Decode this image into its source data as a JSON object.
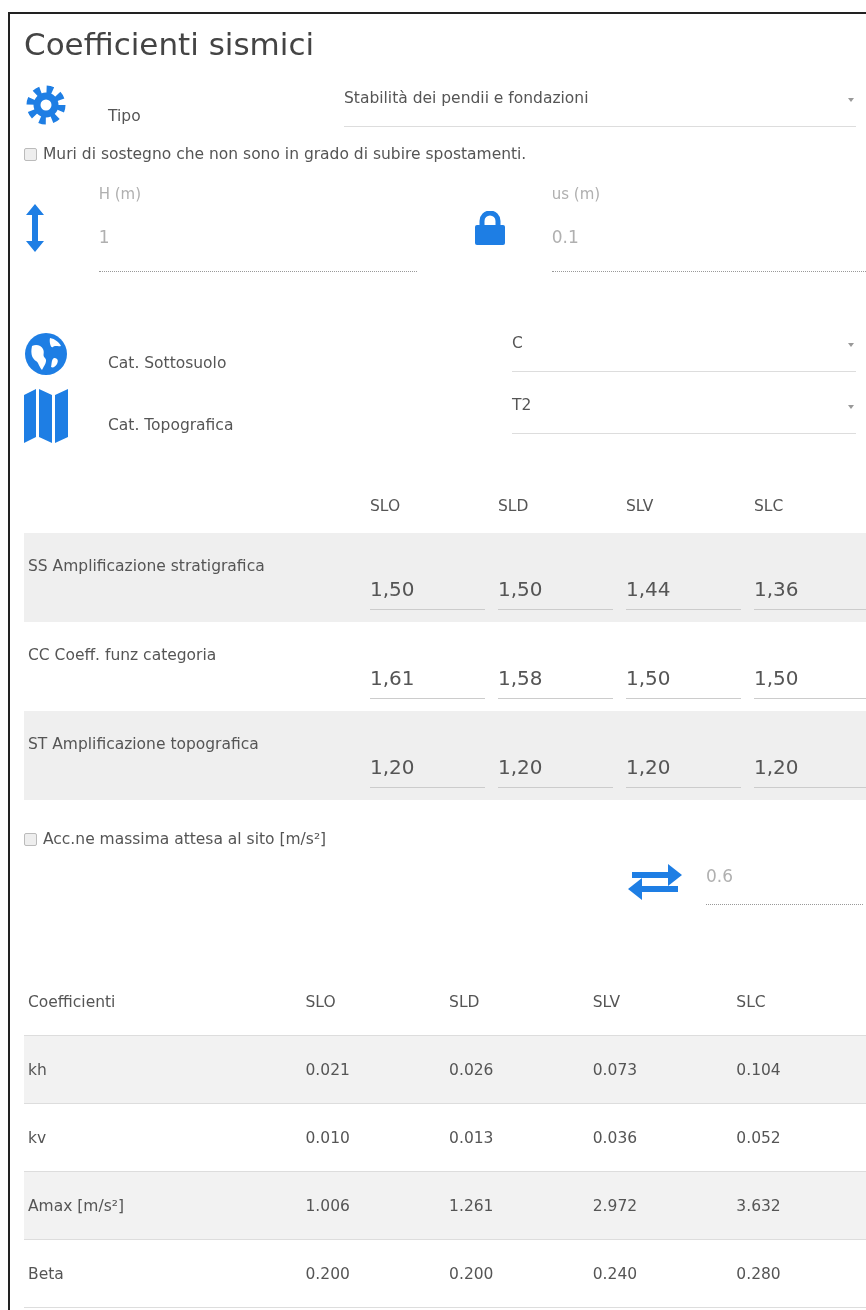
{
  "title": "Coefficienti sismici",
  "tipo": {
    "label": "Tipo",
    "value": "Stabilità dei pendii e fondazioni"
  },
  "muri_checkbox": {
    "label": "Muri di sostegno che non sono in grado di subire spostamenti.",
    "checked": false
  },
  "fields": [
    {
      "label": "H (m)",
      "value": "1",
      "disabled": true
    },
    {
      "label": "us (m)",
      "value": "0.1",
      "disabled": true
    }
  ],
  "categories": [
    {
      "label": "Cat. Sottosuolo",
      "value": "C"
    },
    {
      "label": "Cat. Topografica",
      "value": "T2"
    }
  ],
  "amplification": {
    "columns": [
      "SLO",
      "SLD",
      "SLV",
      "SLC"
    ],
    "rows": [
      {
        "label": "SS Amplificazione stratigrafica",
        "values": [
          "1,50",
          "1,50",
          "1,44",
          "1,36"
        ]
      },
      {
        "label": "CC Coeff. funz categoria",
        "values": [
          "1,61",
          "1,58",
          "1,50",
          "1,50"
        ]
      },
      {
        "label": "ST Amplificazione topografica",
        "values": [
          "1,20",
          "1,20",
          "1,20",
          "1,20"
        ]
      }
    ]
  },
  "acc_checkbox": {
    "label": "Acc.ne massima attesa al sito [m/s²]",
    "checked": false
  },
  "acc_field": {
    "value": "0.6",
    "disabled": true
  },
  "coefficients": {
    "columns": [
      "Coefficienti",
      "SLO",
      "SLD",
      "SLV",
      "SLC"
    ],
    "rows": [
      [
        "kh",
        "0.021",
        "0.026",
        "0.073",
        "0.104"
      ],
      [
        "kv",
        "0.010",
        "0.013",
        "0.036",
        "0.052"
      ],
      [
        "Amax [m/s²]",
        "1.006",
        "1.261",
        "2.972",
        "3.632"
      ],
      [
        "Beta",
        "0.200",
        "0.200",
        "0.240",
        "0.280"
      ]
    ]
  }
}
